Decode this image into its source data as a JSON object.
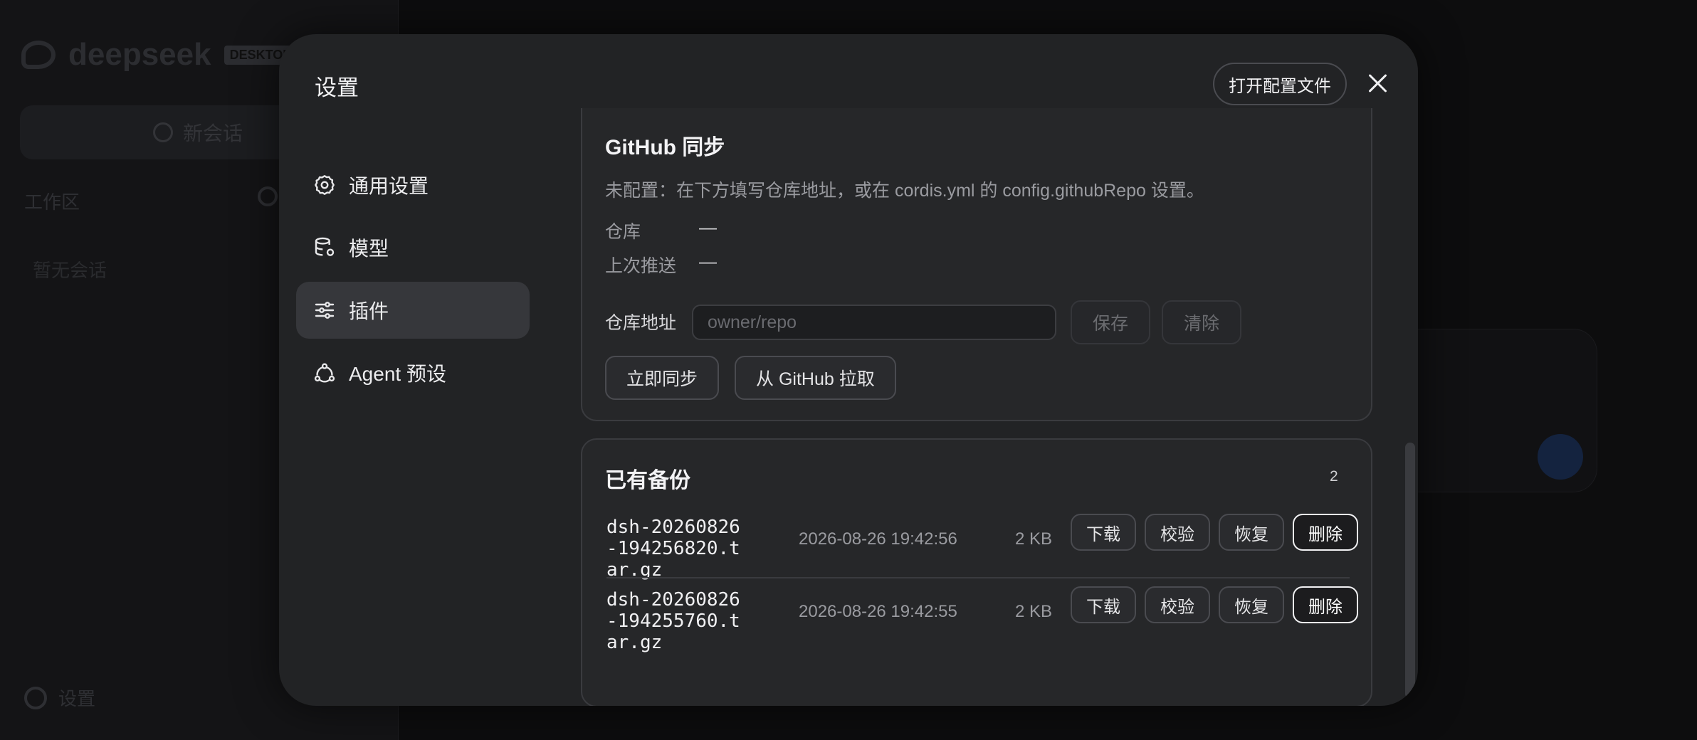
{
  "background": {
    "logo_text": "deepseek",
    "logo_tag": "DESKTOP",
    "new_chat_label": "新会话",
    "workspace_label": "工作区",
    "empty_label": "暂无会话",
    "settings_label": "设置"
  },
  "modal": {
    "title": "设置",
    "open_config_label": "打开配置文件",
    "close_icon": "close-icon"
  },
  "nav": {
    "items": [
      {
        "label": "通用设置",
        "icon": "gear-icon"
      },
      {
        "label": "模型",
        "icon": "database-icon"
      },
      {
        "label": "插件",
        "icon": "sliders-icon"
      },
      {
        "label": "Agent 预设",
        "icon": "agent-icon"
      }
    ],
    "active_index": 2
  },
  "github": {
    "title": "GitHub 同步",
    "description": "未配置：在下方填写仓库地址，或在 cordis.yml 的 config.githubRepo 设置。",
    "repo_label": "仓库",
    "repo_value": "—",
    "last_push_label": "上次推送",
    "last_push_value": "—",
    "repo_url_label": "仓库地址",
    "repo_url_placeholder": "owner/repo",
    "repo_url_value": "",
    "save_label": "保存",
    "clear_label": "清除",
    "sync_now_label": "立即同步",
    "pull_label": "从 GitHub 拉取"
  },
  "backups": {
    "title": "已有备份",
    "count": "2",
    "items": [
      {
        "name": "dsh-20260826-194256820.tar.gz",
        "date": "2026-08-26 19:42:56",
        "size": "2 KB",
        "download_label": "下载",
        "verify_label": "校验",
        "restore_label": "恢复",
        "delete_label": "删除"
      },
      {
        "name": "dsh-20260826-194255760.tar.gz",
        "date": "2026-08-26 19:42:55",
        "size": "2 KB",
        "download_label": "下载",
        "verify_label": "校验",
        "restore_label": "恢复",
        "delete_label": "删除"
      }
    ]
  }
}
